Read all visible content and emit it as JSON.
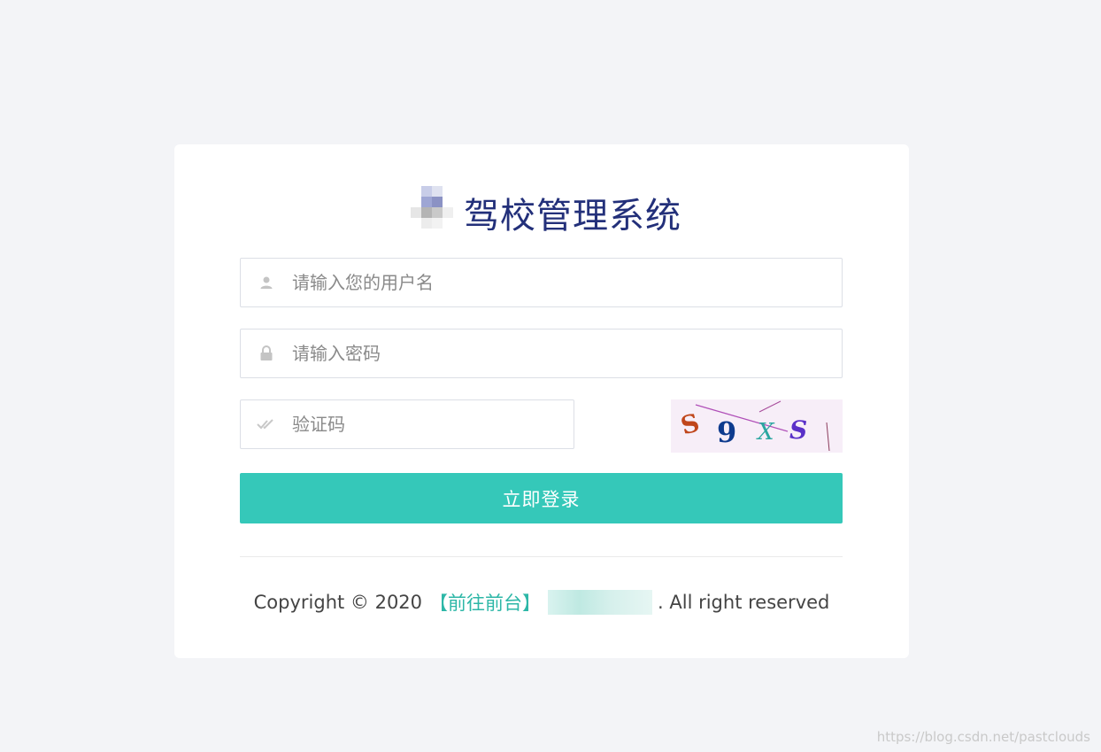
{
  "brand": {
    "title": "驾校管理系统"
  },
  "form": {
    "username": {
      "placeholder": "请输入您的用户名",
      "value": ""
    },
    "password": {
      "placeholder": "请输入密码",
      "value": ""
    },
    "captcha": {
      "placeholder": "验证码",
      "value": "",
      "image_text": "S9XS"
    }
  },
  "login_button": {
    "label": "立即登录"
  },
  "footer": {
    "copyright": "Copyright © 2020",
    "link": "【前往前台】",
    "suffix": ". All right reserved"
  },
  "watermark": "https://blog.csdn.net/pastclouds",
  "colors": {
    "accent": "#35c8b9",
    "title": "#23307a",
    "link": "#2db7a7",
    "background": "#f3f4f7"
  },
  "icons": {
    "username": "user-icon",
    "password": "lock-icon",
    "captcha": "check-icon"
  }
}
